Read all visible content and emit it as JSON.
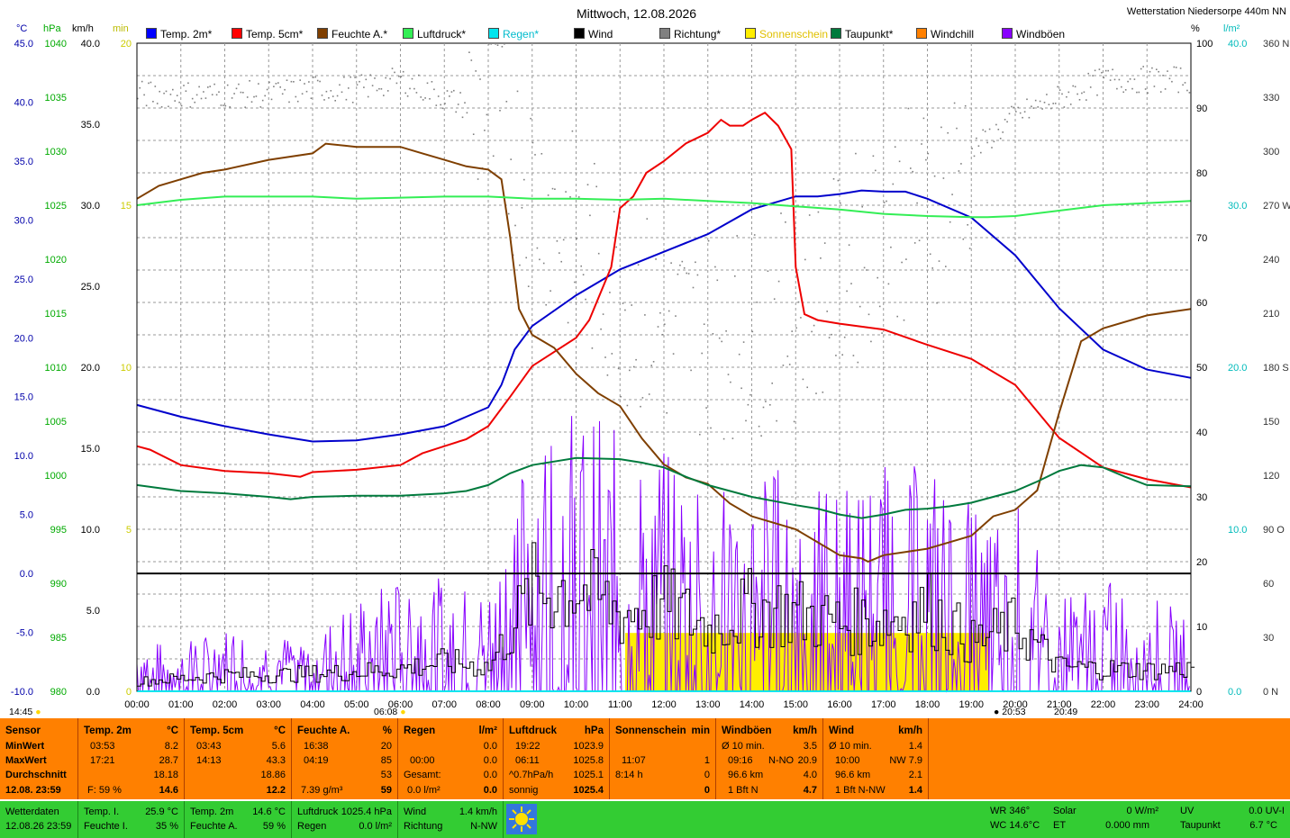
{
  "header": {
    "title": "Mittwoch, 12.08.2026",
    "station": "Wetterstation Niedersorpe 440m NN",
    "unit_left": [
      "°C",
      "hPa",
      "km/h",
      "min"
    ],
    "unit_right": [
      "%",
      "l/m²"
    ]
  },
  "legend": [
    {
      "label": "Temp. 2m*",
      "color": "#0000ff"
    },
    {
      "label": "Temp. 5cm*",
      "color": "#ff0000"
    },
    {
      "label": "Feuchte A.*",
      "color": "#7f3f00"
    },
    {
      "label": "Luftdruck*",
      "color": "#33ee55"
    },
    {
      "label": "Regen*",
      "color": "#00e5ee"
    },
    {
      "label": "Wind",
      "color": "#000000"
    },
    {
      "label": "Richtung*",
      "color": "#808080"
    },
    {
      "label": "Sonnenschein",
      "color": "#ffee00"
    },
    {
      "label": "Taupunkt*",
      "color": "#007a3d"
    },
    {
      "label": "Windchill",
      "color": "#ff8000"
    },
    {
      "label": "Windböen",
      "color": "#8800ff"
    }
  ],
  "chart_data": {
    "type": "line",
    "x_ticks": [
      "00:00",
      "01:00",
      "02:00",
      "03:00",
      "04:00",
      "05:00",
      "06:00",
      "07:00",
      "08:00",
      "09:00",
      "10:00",
      "11:00",
      "12:00",
      "13:00",
      "14:00",
      "15:00",
      "16:00",
      "17:00",
      "18:00",
      "19:00",
      "20:00",
      "21:00",
      "22:00",
      "23:00",
      "24:00"
    ],
    "axes": {
      "temp_c": {
        "ticks": [
          "45.0",
          "40.0",
          "35.0",
          "30.0",
          "25.0",
          "20.0",
          "15.0",
          "10.0",
          "5.0",
          "0.0",
          "-5.0",
          "-10.0"
        ],
        "range": [
          -10,
          45
        ],
        "color": "#0000aa"
      },
      "pressure_hpa": {
        "ticks": [
          "1040",
          "1035",
          "1030",
          "1025",
          "1020",
          "1015",
          "1010",
          "1005",
          "1000",
          "995",
          "990",
          "985",
          "980"
        ],
        "range": [
          980,
          1040
        ],
        "color": "#00aa00"
      },
      "kmh": {
        "ticks": [
          "40.0",
          "35.0",
          "30.0",
          "25.0",
          "20.0",
          "15.0",
          "10.0",
          "5.0",
          "0.0"
        ],
        "range": [
          0,
          40
        ],
        "color": "#000000"
      },
      "min": {
        "ticks": [
          "20",
          "15",
          "10",
          "5",
          "0"
        ],
        "range": [
          0,
          20
        ],
        "color": "#cccc00"
      },
      "percent": {
        "ticks": [
          "100",
          "90",
          "80",
          "70",
          "60",
          "50",
          "40",
          "30",
          "20",
          "10",
          "0"
        ],
        "range": [
          0,
          100
        ],
        "color": "#000000"
      },
      "rain_lm2": {
        "ticks": [
          "40.0",
          "30.0",
          "20.0",
          "10.0",
          "0.0"
        ],
        "range": [
          0,
          40
        ],
        "color": "#00bbbb"
      },
      "direction": {
        "ticks": [
          "360 N",
          "330",
          "300",
          "270 W",
          "240",
          "210",
          "180 S",
          "150",
          "120",
          "90 O",
          "60",
          "30",
          "0 N"
        ],
        "range": [
          0,
          360
        ]
      }
    },
    "series": [
      {
        "name": "Temp. 2m*",
        "color": "#0000cc",
        "axis": "temp_c",
        "x": [
          0,
          1,
          2,
          3,
          4,
          5,
          6,
          7,
          7.5,
          8,
          8.3,
          8.6,
          9,
          10,
          11,
          12,
          13,
          14,
          15,
          15.5,
          16,
          16.5,
          17,
          17.5,
          18,
          19,
          20,
          21,
          22,
          23,
          24
        ],
        "y": [
          14.3,
          13.3,
          12.5,
          11.8,
          11.2,
          11.3,
          11.8,
          12.5,
          13.3,
          14.1,
          16,
          19,
          21,
          23.6,
          25.8,
          27.3,
          28.8,
          30.9,
          32,
          32,
          32.2,
          32.5,
          32.4,
          32.4,
          31.8,
          30.2,
          27,
          22.5,
          19,
          17.3,
          16.6
        ]
      },
      {
        "name": "Temp. 5cm*",
        "color": "#ee0000",
        "axis": "temp_c",
        "x": [
          0,
          0.3,
          1,
          2,
          3,
          3.72,
          4,
          5,
          6,
          6.5,
          7,
          7.5,
          8,
          8.5,
          9,
          10,
          10.3,
          10.8,
          11,
          11.3,
          11.6,
          12,
          12.5,
          13,
          13.3,
          13.5,
          13.8,
          14,
          14.3,
          14.6,
          14.9,
          15,
          15.2,
          15.5,
          16,
          17,
          18,
          19,
          20,
          21,
          22,
          23,
          24
        ],
        "y": [
          10.8,
          10.5,
          9.2,
          8.7,
          8.5,
          8.2,
          8.6,
          8.8,
          9.2,
          10.2,
          10.8,
          11.4,
          12.5,
          15,
          17.6,
          20,
          21.5,
          26,
          31,
          32,
          34,
          35,
          36.5,
          37.4,
          38.5,
          38,
          38,
          38.5,
          39.1,
          38,
          36,
          26,
          22,
          21.5,
          21.2,
          20.7,
          19.4,
          18.2,
          16,
          11.5,
          9,
          8,
          7.3
        ]
      },
      {
        "name": "Feuchte A.*",
        "color": "#7f3f00",
        "axis": "percent",
        "x": [
          0,
          0.5,
          1,
          1.5,
          2,
          3,
          3.5,
          4,
          4.3,
          5,
          6,
          6.5,
          7,
          7.5,
          8,
          8.3,
          8.5,
          8.7,
          9,
          9.5,
          10,
          10.5,
          11,
          11.5,
          12,
          12.5,
          13,
          13.5,
          14,
          14.5,
          15,
          15.5,
          16,
          16.5,
          16.65,
          17,
          17.5,
          18,
          18.5,
          19,
          19.5,
          20,
          20.5,
          21,
          21.5,
          22,
          23,
          24
        ],
        "y": [
          76,
          78,
          79,
          80,
          80.5,
          82,
          82.5,
          83,
          84.5,
          84,
          84,
          83,
          82,
          81,
          80.5,
          79,
          70,
          59,
          55,
          53,
          49,
          46,
          44,
          39,
          35,
          33,
          32,
          29,
          27,
          26,
          25,
          23,
          21,
          20.5,
          20,
          21,
          21.5,
          22,
          23,
          24,
          27,
          28,
          31,
          43,
          54,
          56,
          58,
          59
        ]
      },
      {
        "name": "Luftdruck*",
        "color": "#33ee55",
        "axis": "pressure_hpa",
        "x": [
          0,
          1,
          2,
          3,
          4,
          5,
          6,
          7,
          8,
          9,
          10,
          11,
          12,
          13,
          14,
          15,
          16,
          17,
          18,
          19,
          19.37,
          20,
          21,
          22,
          23,
          24
        ],
        "y": [
          1025,
          1025.5,
          1025.8,
          1025.8,
          1025.8,
          1025.6,
          1025.7,
          1025.8,
          1025.8,
          1025.6,
          1025.6,
          1025.5,
          1025.6,
          1025.4,
          1025.2,
          1024.9,
          1024.6,
          1024.2,
          1024,
          1023.9,
          1023.9,
          1024,
          1024.5,
          1025,
          1025.2,
          1025.4
        ]
      },
      {
        "name": "Taupunkt*",
        "color": "#007a3d",
        "axis": "temp_c",
        "x": [
          0,
          1,
          2,
          3,
          3.5,
          4,
          5,
          6,
          7,
          7.5,
          8,
          8.5,
          9,
          10,
          11,
          11.5,
          12,
          12.5,
          13,
          14,
          15,
          15.5,
          16,
          16.5,
          17,
          17.5,
          18,
          18.5,
          19,
          19.5,
          20,
          20.5,
          21,
          21.5,
          22,
          22.5,
          23,
          24
        ],
        "y": [
          7.5,
          7,
          6.8,
          6.5,
          6.3,
          6.5,
          6.6,
          6.6,
          6.8,
          7,
          7.5,
          8.5,
          9.2,
          9.8,
          9.7,
          9.4,
          9,
          8.2,
          7.5,
          6.5,
          5.8,
          5.5,
          5,
          4.7,
          5,
          5.4,
          5.5,
          5.7,
          6,
          6.5,
          7,
          7.8,
          8.7,
          9.2,
          9,
          8.2,
          7.5,
          7.4
        ]
      }
    ],
    "wind_avg_kmh": [
      0.6,
      0.8,
      1.0,
      1.0,
      1.1,
      1.2,
      1.4,
      1.8,
      1.5,
      6.2,
      6.4,
      4.8,
      5.3,
      3.9,
      5.2,
      4.8,
      4.2,
      4.4,
      5.1,
      3.0,
      4.0,
      1.5,
      1.4,
      1.3,
      1.4
    ],
    "wind_gust_kmh": [
      3.0,
      3.0,
      4.0,
      3.5,
      3.5,
      6.0,
      7.0,
      7.0,
      6.0,
      17.0,
      18.0,
      16.0,
      15.0,
      13.0,
      14.0,
      14.0,
      13.0,
      14.0,
      14.0,
      12.0,
      12.0,
      6.0,
      7.0,
      6.0,
      5.0
    ],
    "sunshine": {
      "from": "11:07",
      "to": "19:24",
      "level_min": 1
    },
    "wind_direction_deg": [
      332,
      332,
      332,
      332,
      335,
      335,
      340,
      330,
      320,
      280,
      250,
      220,
      200,
      200,
      200,
      210,
      230,
      260,
      270,
      300,
      320,
      330,
      340,
      340,
      340
    ],
    "rain_lm2": 0.0,
    "sun_marks": [
      {
        "label": "06:08"
      },
      {
        "label": "20:53"
      },
      {
        "label": "20:49"
      }
    ],
    "corner_time": "14:45",
    "ylim_temp": [
      -10,
      45
    ]
  },
  "stats": {
    "labels": [
      "Sensor",
      "MinWert",
      "MaxWert",
      "Durchschnitt",
      "12.08. 23:59"
    ],
    "temp2m": {
      "title": "Temp. 2m",
      "unit": "°C",
      "min_time": "03:53",
      "min_val": "8.2",
      "max_time": "17:21",
      "max_val": "28.7",
      "avg": "18.18",
      "extra": "F: 59 %",
      "current": "14.6"
    },
    "temp5cm": {
      "title": "Temp. 5cm",
      "unit": "°C",
      "min_time": "03:43",
      "min_val": "5.6",
      "max_time": "14:13",
      "max_val": "43.3",
      "avg": "18.86",
      "current": "12.2"
    },
    "humidity": {
      "title": "Feuchte A.",
      "unit": "%",
      "min_time": "16:38",
      "min_val": "20",
      "max_time": "04:19",
      "max_val": "85",
      "avg": "53",
      "extra": "7.39 g/m³",
      "current": "59"
    },
    "rain": {
      "title": "Regen",
      "unit": "l/m²",
      "r1_l": "",
      "r1_v": "0.0",
      "r2_l": "00:00",
      "r2_v": "0.0",
      "r3_l": "Gesamt:",
      "r3_v": "0.0",
      "r4_l": "0.0 l/m²",
      "r4_v": "0.0"
    },
    "pressure": {
      "title": "Luftdruck",
      "unit": "hPa",
      "r1_l": "19:22",
      "r1_v": "1023.9",
      "r2_l": "06:11",
      "r2_v": "1025.8",
      "r3_l": "^0.7hPa/h",
      "r3_v": "1025.1",
      "r4_l": "sonnig",
      "r4_v": "1025.4"
    },
    "sunshine": {
      "title": "Sonnenschein",
      "unit": "min",
      "r2_l": "11:07",
      "r2_v": "1",
      "r3_l": "8:14 h",
      "r3_v": "0",
      "r4_v": "0"
    },
    "gusts": {
      "title": "Windböen",
      "unit": "km/h",
      "r1_l": "Ø 10 min.",
      "r1_v": "3.5",
      "r2_l": "09:16",
      "r2_m": "N-NO",
      "r2_v": "20.9",
      "r3_l": "96.6 km",
      "r3_v": "4.0",
      "r4_l": "1 Bft N",
      "r4_v": "4.7"
    },
    "wind": {
      "title": "Wind",
      "unit": "km/h",
      "r1_l": "Ø 10 min.",
      "r1_v": "1.4",
      "r2_l": "10:00",
      "r2_v": "NW 7.9",
      "r3_l": "96.6 km",
      "r3_v": "2.1",
      "r4_l": "1 Bft N-NW",
      "r4_v": "1.4"
    }
  },
  "footer": {
    "station_label": "Wetterdaten",
    "station_time": "12.08.26 23:59",
    "tempI_l": "Temp. I.",
    "tempI_v": "25.9 °C",
    "feuchteI_l": "Feuchte I.",
    "feuchteI_v": "35 %",
    "temp2m_l": "Temp. 2m",
    "temp2m_v": "14.6 °C",
    "feuchteA_l": "Feuchte A.",
    "feuchteA_v": "59 %",
    "luftdruck_l": "Luftdruck",
    "luftdruck_v": "1025.4 hPa",
    "regen_l": "Regen",
    "regen_v": "0.0 l/m²",
    "wind_l": "Wind",
    "wind_v": "1.4 km/h",
    "richtung_l": "Richtung",
    "richtung_v": "N-NW",
    "wr": "WR 346°",
    "wc": "WC 14.6°C",
    "solar_l": "Solar",
    "solar_v": "0 W/m²",
    "et_l": "ET",
    "et_v": "0.000 mm",
    "uv_l": "UV",
    "uv_v": "0.0 UV-I",
    "taupunkt_l": "Taupunkt",
    "taupunkt_v": "6.7 °C"
  }
}
